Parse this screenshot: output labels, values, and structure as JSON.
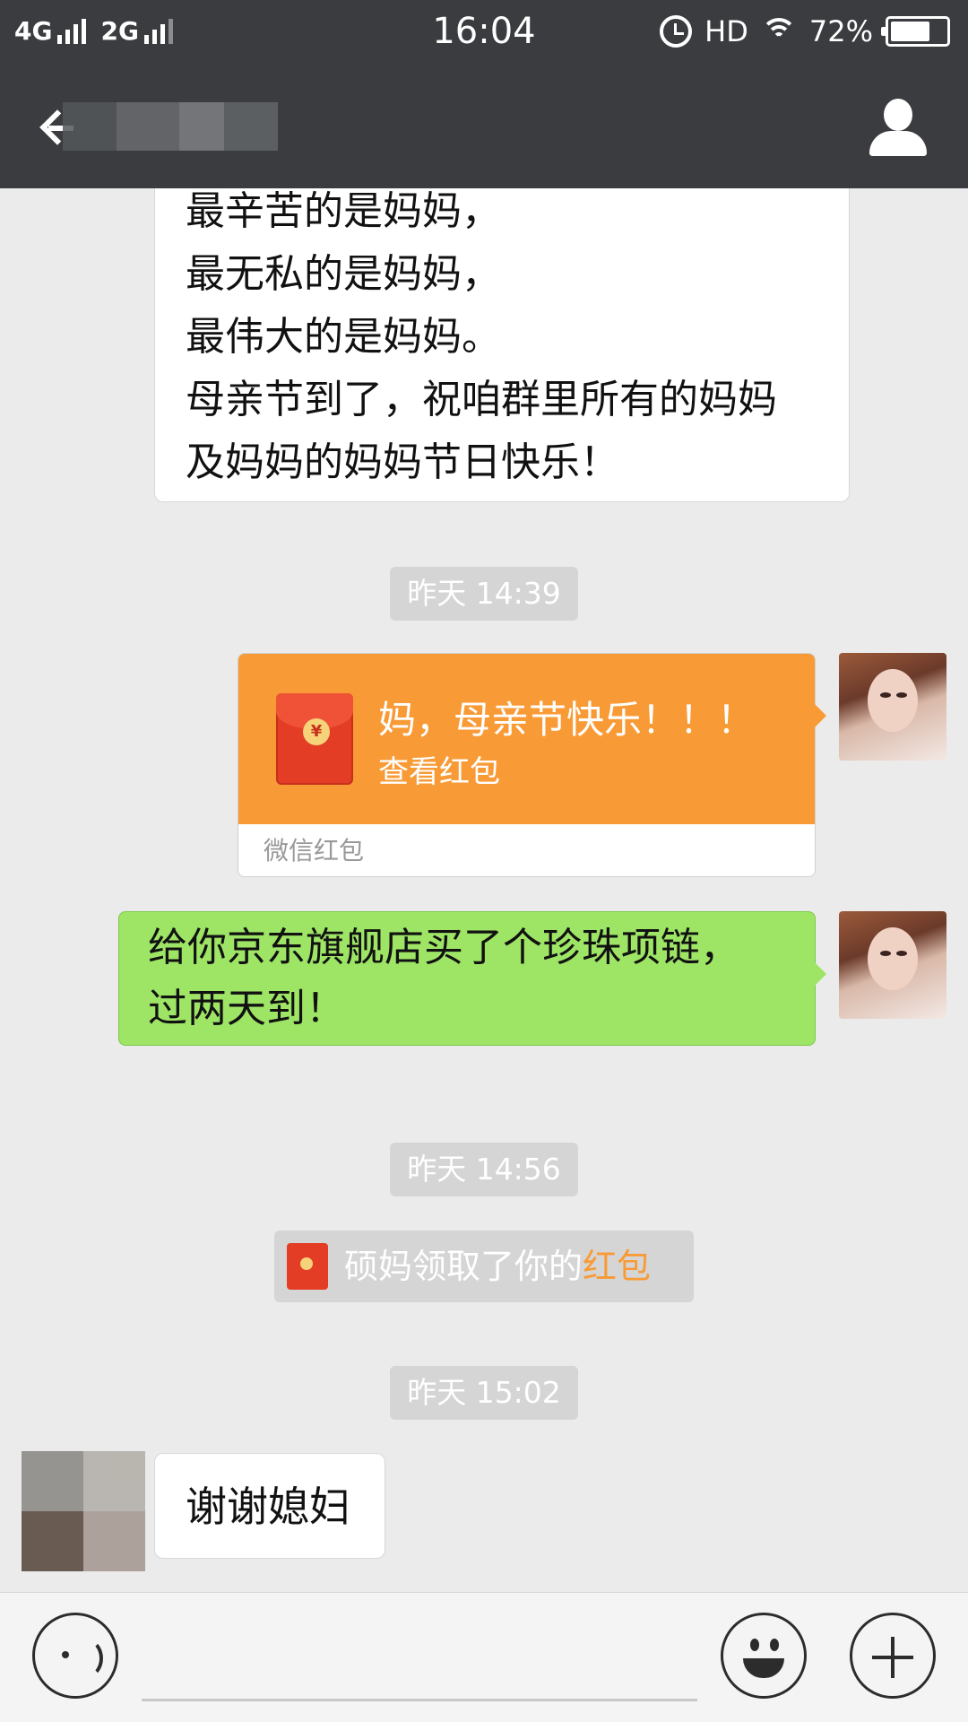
{
  "status_bar": {
    "network_1": "4G",
    "network_2": "2G",
    "time": "16:04",
    "hd": "HD",
    "battery_percent": "72%",
    "battery_level": 0.72
  },
  "title_bar": {
    "back_icon": "back-arrow-icon",
    "profile_icon": "person-icon"
  },
  "messages": {
    "poem_lines": [
      "最辛苦的是妈妈，",
      "最无私的是妈妈，",
      "最伟大的是妈妈。",
      "母亲节到了，祝咱群里所有的妈妈",
      "及妈妈的妈妈节日快乐！"
    ],
    "timestamp_1": "昨天 14:39",
    "red_packet": {
      "title": "妈，母亲节快乐！！！",
      "subtitle": "查看红包",
      "footer": "微信红包",
      "color": "#f89b36"
    },
    "green_lines": [
      "给你京东旗舰店买了个珍珠项链，",
      "过两天到！"
    ],
    "timestamp_2": "昨天 14:56",
    "system_message": {
      "prefix": "硕妈领取了你的",
      "link": "红包"
    },
    "timestamp_3": "昨天 15:02",
    "reply": "谢谢媳妇"
  },
  "input_bar": {
    "voice_icon": "voice-icon",
    "emoji_icon": "emoji-icon",
    "plus_icon": "plus-icon"
  }
}
